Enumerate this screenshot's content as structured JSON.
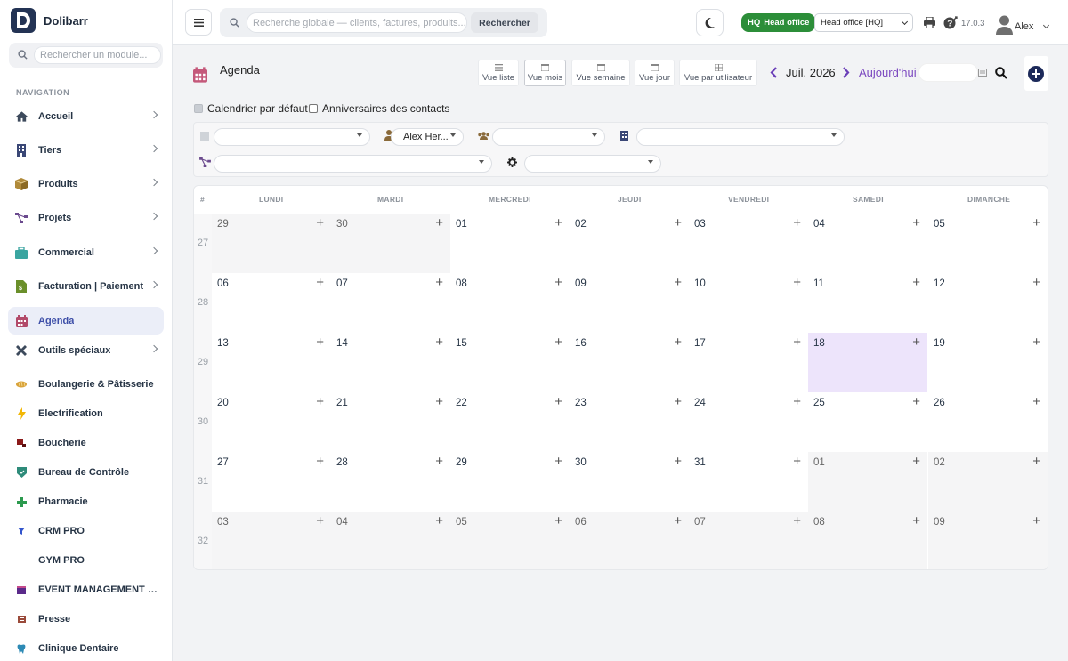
{
  "brand": {
    "name": "Dolibarr"
  },
  "sidebar": {
    "search_placeholder": "Rechercher un module...",
    "nav_title": "NAVIGATION",
    "items": [
      {
        "label": "Accueil",
        "icon": "home-icon"
      },
      {
        "label": "Tiers",
        "icon": "building-icon"
      },
      {
        "label": "Produits",
        "icon": "box-icon"
      },
      {
        "label": "Projets",
        "icon": "project-icon"
      },
      {
        "label": "Commercial",
        "icon": "briefcase-icon"
      },
      {
        "label": "Facturation | Paiement",
        "icon": "invoice-icon"
      },
      {
        "label": "Agenda",
        "icon": "calendar-icon"
      },
      {
        "label": "Outils spéciaux",
        "icon": "tools-icon"
      },
      {
        "label": "Boulangerie & Pâtisserie",
        "icon": "bread-icon"
      },
      {
        "label": "Electrification",
        "icon": "lightning-icon"
      },
      {
        "label": "Boucherie",
        "icon": "meat-icon"
      },
      {
        "label": "Bureau de Contrôle",
        "icon": "shield-icon"
      },
      {
        "label": "Pharmacie",
        "icon": "pharmacy-cross-icon"
      },
      {
        "label": "CRM PRO",
        "icon": "funnel-icon"
      },
      {
        "label": "GYM PRO",
        "icon": ""
      },
      {
        "label": "EVENT MANAGEMENT P...",
        "icon": "event-icon"
      },
      {
        "label": "Presse",
        "icon": "press-icon"
      },
      {
        "label": "Clinique Dentaire",
        "icon": "tooth-icon"
      }
    ]
  },
  "topbar": {
    "search_placeholder": "Recherche globale — clients, factures, produits...",
    "search_button": "Rechercher",
    "entity_badge": "HQ Head office",
    "entity_badge_short": "HQ",
    "entity_badge_label": "Head office",
    "entity_select": "Head office [HQ]",
    "version": "17.0.3",
    "user": "Alex"
  },
  "agenda": {
    "title": "Agenda",
    "views": [
      "Vue liste",
      "Vue mois",
      "Vue semaine",
      "Vue jour",
      "Vue par utilisateur"
    ],
    "active_view": "Vue mois",
    "month": "Juil. 2026",
    "today_label": "Aujourd'hui",
    "checkboxes": [
      {
        "label": "Calendrier par défaut",
        "checked": true
      },
      {
        "label": "Anniversaires des contacts",
        "checked": false
      }
    ],
    "filters": {
      "user": "Alex Her..."
    },
    "headers": [
      "#",
      "LUNDI",
      "MARDI",
      "MERCREDI",
      "JEUDI",
      "VENDREDI",
      "SAMEDI",
      "DIMANCHE"
    ],
    "weeks": [
      {
        "num": "27",
        "days": [
          "29",
          "30",
          "01",
          "02",
          "03",
          "04",
          "05"
        ]
      },
      {
        "num": "28",
        "days": [
          "06",
          "07",
          "08",
          "09",
          "10",
          "11",
          "12"
        ]
      },
      {
        "num": "29",
        "days": [
          "13",
          "14",
          "15",
          "16",
          "17",
          "18",
          "19"
        ]
      },
      {
        "num": "30",
        "days": [
          "20",
          "21",
          "22",
          "23",
          "24",
          "25",
          "26"
        ]
      },
      {
        "num": "31",
        "days": [
          "27",
          "28",
          "29",
          "30",
          "31",
          "01",
          "02"
        ]
      },
      {
        "num": "32",
        "days": [
          "03",
          "04",
          "05",
          "06",
          "07",
          "08",
          "09"
        ]
      }
    ],
    "today_date": "18",
    "colors": {
      "accent": "#7c49c0",
      "today": "#ede4fb",
      "badge": "#2c8e39",
      "brand": "#233354"
    }
  }
}
